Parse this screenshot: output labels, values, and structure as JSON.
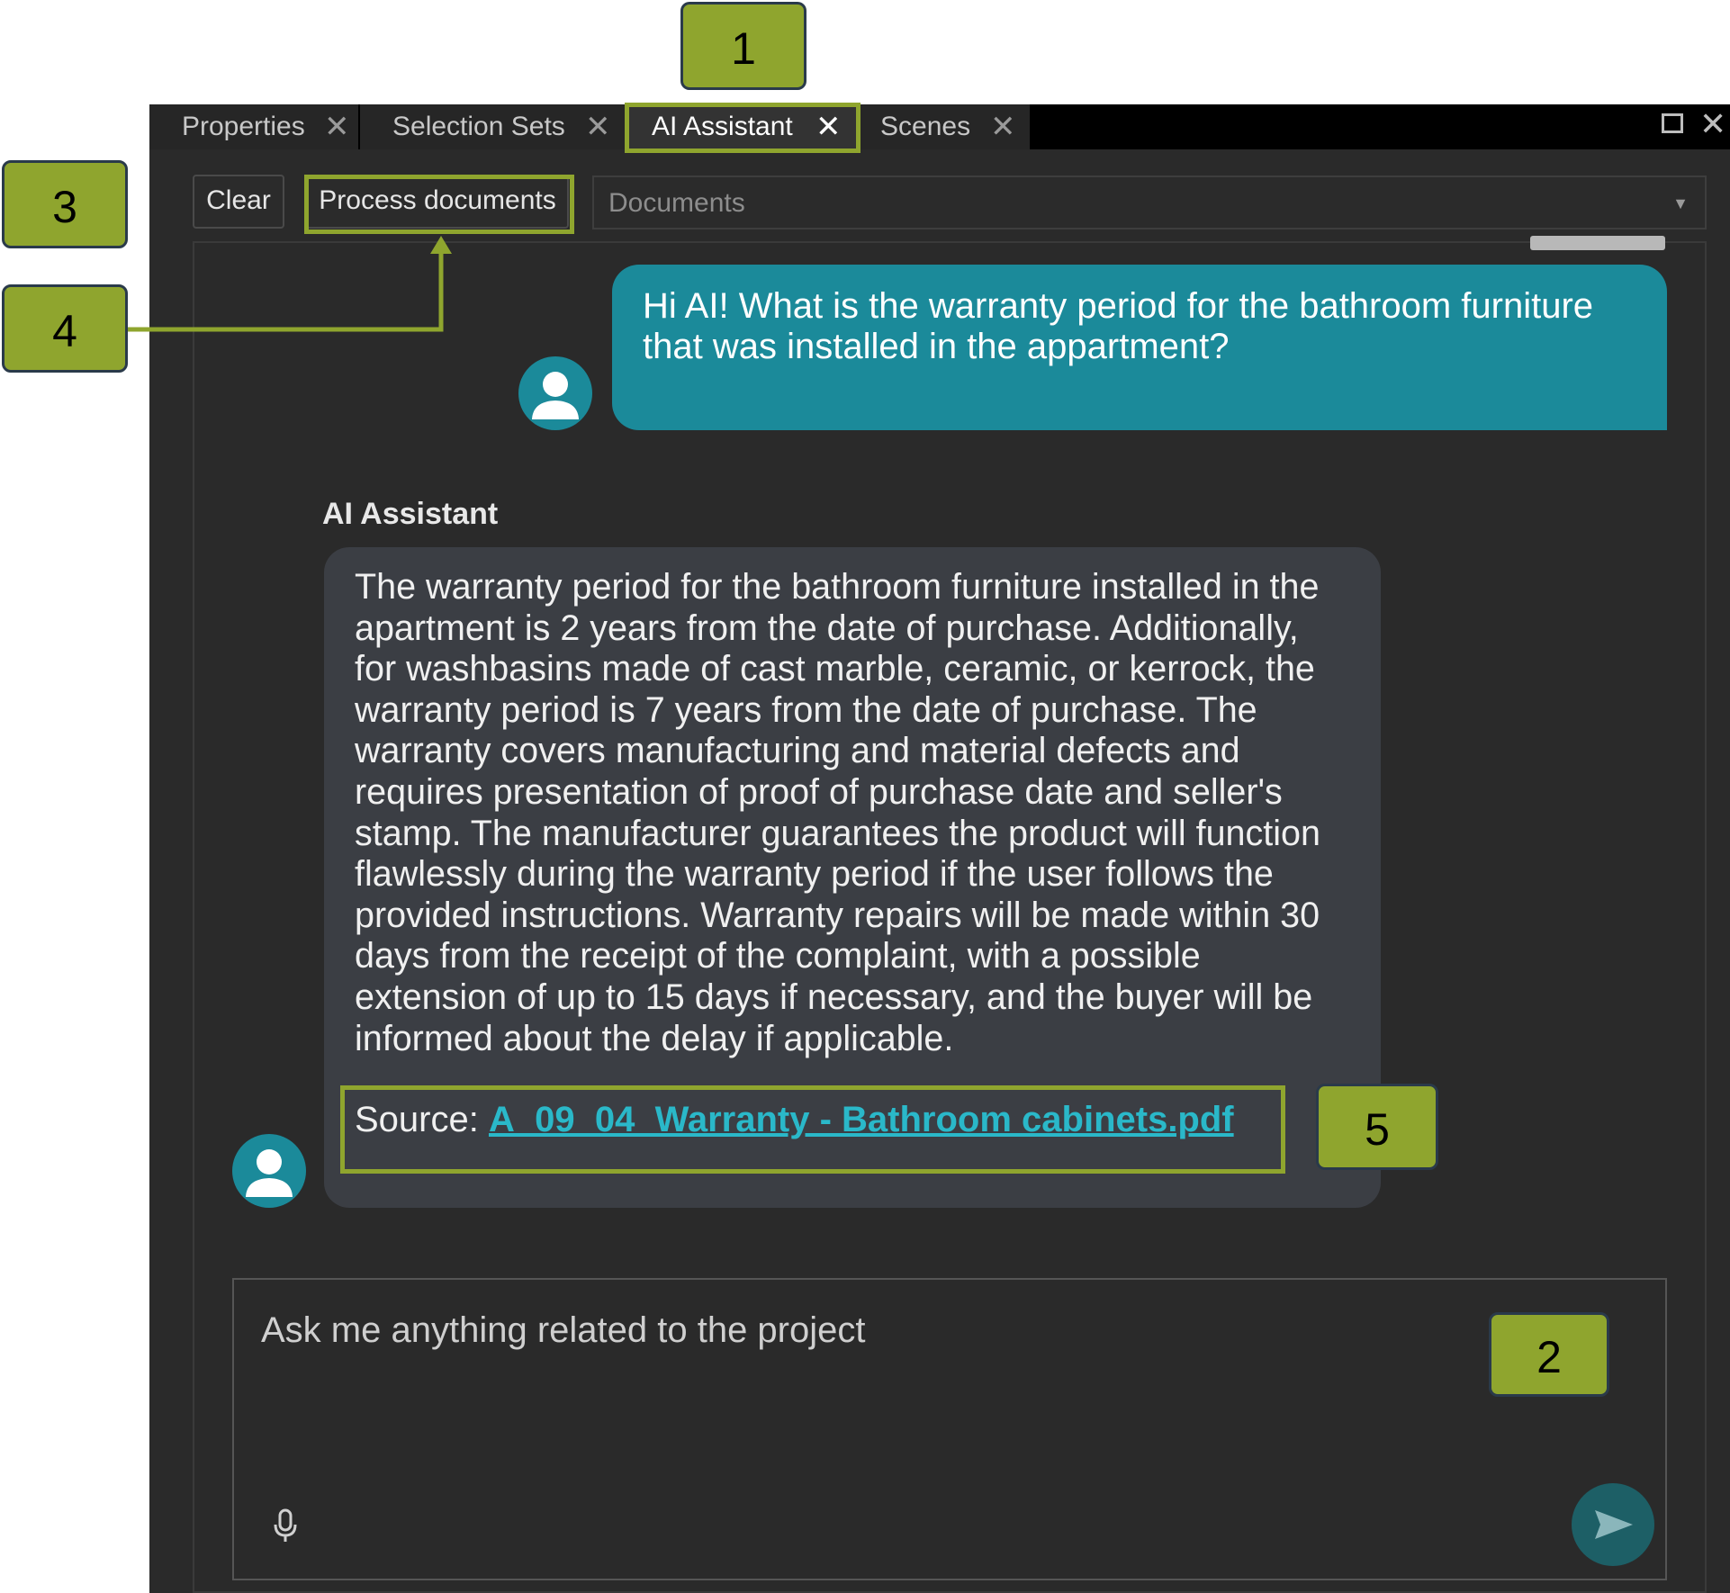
{
  "tabs": [
    {
      "label": "Properties",
      "active": false
    },
    {
      "label": "Selection Sets",
      "active": false
    },
    {
      "label": "AI Assistant",
      "active": true
    },
    {
      "label": "Scenes",
      "active": false
    }
  ],
  "toolbar": {
    "clear_label": "Clear",
    "process_label": "Process documents",
    "documents_placeholder": "Documents"
  },
  "chat": {
    "user_message": "Hi AI! What is the warranty period for the bathroom furniture that was installed in the appartment?",
    "ai_sender": "AI Assistant",
    "ai_message": "The warranty period for the bathroom furniture installed in the apartment is 2 years from the date of purchase. Additionally, for washbasins made of cast marble, ceramic, or kerrock, the warranty period is 7 years from the date of purchase. The warranty covers manufacturing and material defects and requires presentation of proof of purchase date and seller's stamp. The manufacturer guarantees the product will function flawlessly during the warranty period if the user follows the provided instructions. Warranty repairs will be made within 30 days from the receipt of the complaint, with a possible extension of up to 15 days if necessary, and the buyer will be informed about the delay if applicable.",
    "source_label": "Source:",
    "source_file": "A_09_04_Warranty - Bathroom cabinets.pdf"
  },
  "input": {
    "placeholder": "Ask me anything related to the project"
  },
  "callouts": [
    "1",
    "2",
    "3",
    "4",
    "5"
  ],
  "colors": {
    "accent": "#1b8a9a",
    "callout": "#8fa52e",
    "link": "#2ab8c9"
  }
}
